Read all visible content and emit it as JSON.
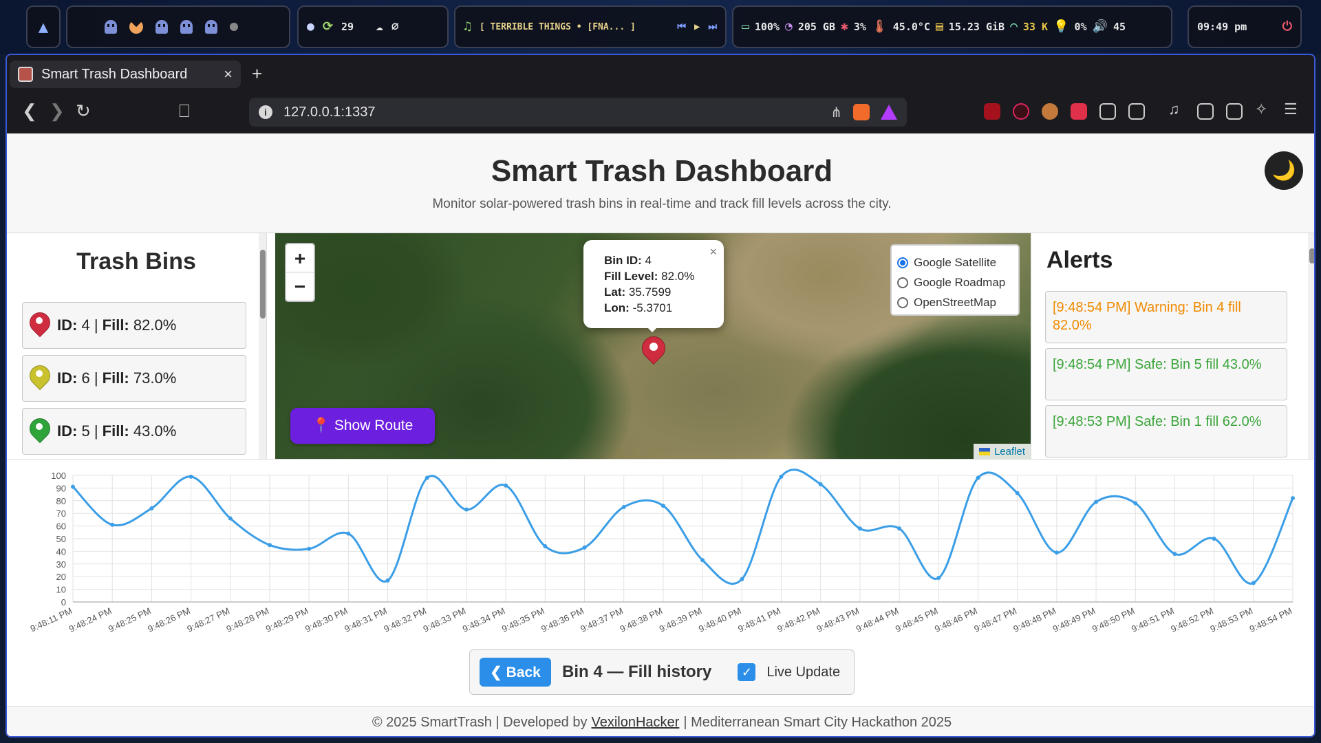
{
  "system_bar": {
    "counter": "29",
    "now_playing": "[ TERRIBLE THINGS • [FNA... ]",
    "battery": "100%",
    "disk": "205 GB",
    "cpu": "3%",
    "temp": "45.0°C",
    "memory": "15.23 GiB",
    "network": "33 K",
    "brightness": "0%",
    "volume": "45",
    "clock": "09:49 pm"
  },
  "browser": {
    "tab_title": "Smart Trash Dashboard",
    "url": "127.0.0.1:1337"
  },
  "page": {
    "title": "Smart Trash Dashboard",
    "subtitle": "Monitor solar-powered trash bins in real-time and track fill levels across the city.",
    "theme_icon": "🌙"
  },
  "bins": {
    "title": "Trash Bins",
    "id_label": "ID:",
    "fill_label": "Fill:",
    "items": [
      {
        "id": "4",
        "fill": "82.0%",
        "color": "#cf2d3f"
      },
      {
        "id": "6",
        "fill": "73.0%",
        "color": "#c9c12e"
      },
      {
        "id": "5",
        "fill": "43.0%",
        "color": "#2fa43a"
      }
    ]
  },
  "map": {
    "zoom_in": "+",
    "zoom_out": "−",
    "popup": {
      "bin_id_label": "Bin ID:",
      "bin_id": "4",
      "fill_label": "Fill Level:",
      "fill": "82.0%",
      "lat_label": "Lat:",
      "lat": "35.7599",
      "lon_label": "Lon:",
      "lon": "-5.3701",
      "close": "×"
    },
    "layers": [
      "Google Satellite",
      "Google Roadmap",
      "OpenStreetMap"
    ],
    "selected_layer": "Google Satellite",
    "route_button": "Show Route",
    "attribution": "Leaflet"
  },
  "alerts": {
    "title": "Alerts",
    "items": [
      {
        "text": "[9:48:54 PM] Warning: Bin 4 fill 82.0%",
        "level": "warning",
        "color": "#f08a00"
      },
      {
        "text": "[9:48:54 PM] Safe: Bin 5 fill 43.0%",
        "level": "safe",
        "color": "#3aa53a"
      },
      {
        "text": "[9:48:53 PM] Safe: Bin 1 fill 62.0%",
        "level": "safe",
        "color": "#3aa53a"
      }
    ]
  },
  "chart_data": {
    "type": "line",
    "title": "",
    "xlabel": "",
    "ylabel": "",
    "ylim": [
      0,
      100
    ],
    "yticks": [
      0,
      10,
      20,
      30,
      40,
      50,
      60,
      70,
      80,
      90,
      100
    ],
    "grid": true,
    "color": "#3b9ee6",
    "categories": [
      "9:48:11 PM",
      "9:48:24 PM",
      "9:48:25 PM",
      "9:48:26 PM",
      "9:48:27 PM",
      "9:48:28 PM",
      "9:48:29 PM",
      "9:48:30 PM",
      "9:48:31 PM",
      "9:48:32 PM",
      "9:48:33 PM",
      "9:48:34 PM",
      "9:48:35 PM",
      "9:48:36 PM",
      "9:48:37 PM",
      "9:48:38 PM",
      "9:48:39 PM",
      "9:48:40 PM",
      "9:48:41 PM",
      "9:48:42 PM",
      "9:48:43 PM",
      "9:48:44 PM",
      "9:48:45 PM",
      "9:48:46 PM",
      "9:48:47 PM",
      "9:48:48 PM",
      "9:48:49 PM",
      "9:48:50 PM",
      "9:48:51 PM",
      "9:48:52 PM",
      "9:48:53 PM",
      "9:48:54 PM"
    ],
    "values": [
      91,
      61,
      74,
      99,
      66,
      45,
      42,
      54,
      17,
      98,
      73,
      92,
      44,
      43,
      75,
      76,
      33,
      18,
      99,
      93,
      58,
      58,
      19,
      98,
      86,
      39,
      79,
      78,
      38,
      50,
      15,
      82
    ]
  },
  "history": {
    "back_label": "❮ Back",
    "title": "Bin 4 — Fill history",
    "live_label": "Live Update",
    "live_checked": true
  },
  "footer": {
    "prefix": "© 2025 SmartTrash | Developed by",
    "author": "VexilonHacker",
    "suffix": "| Mediterranean Smart City Hackathon 2025"
  }
}
